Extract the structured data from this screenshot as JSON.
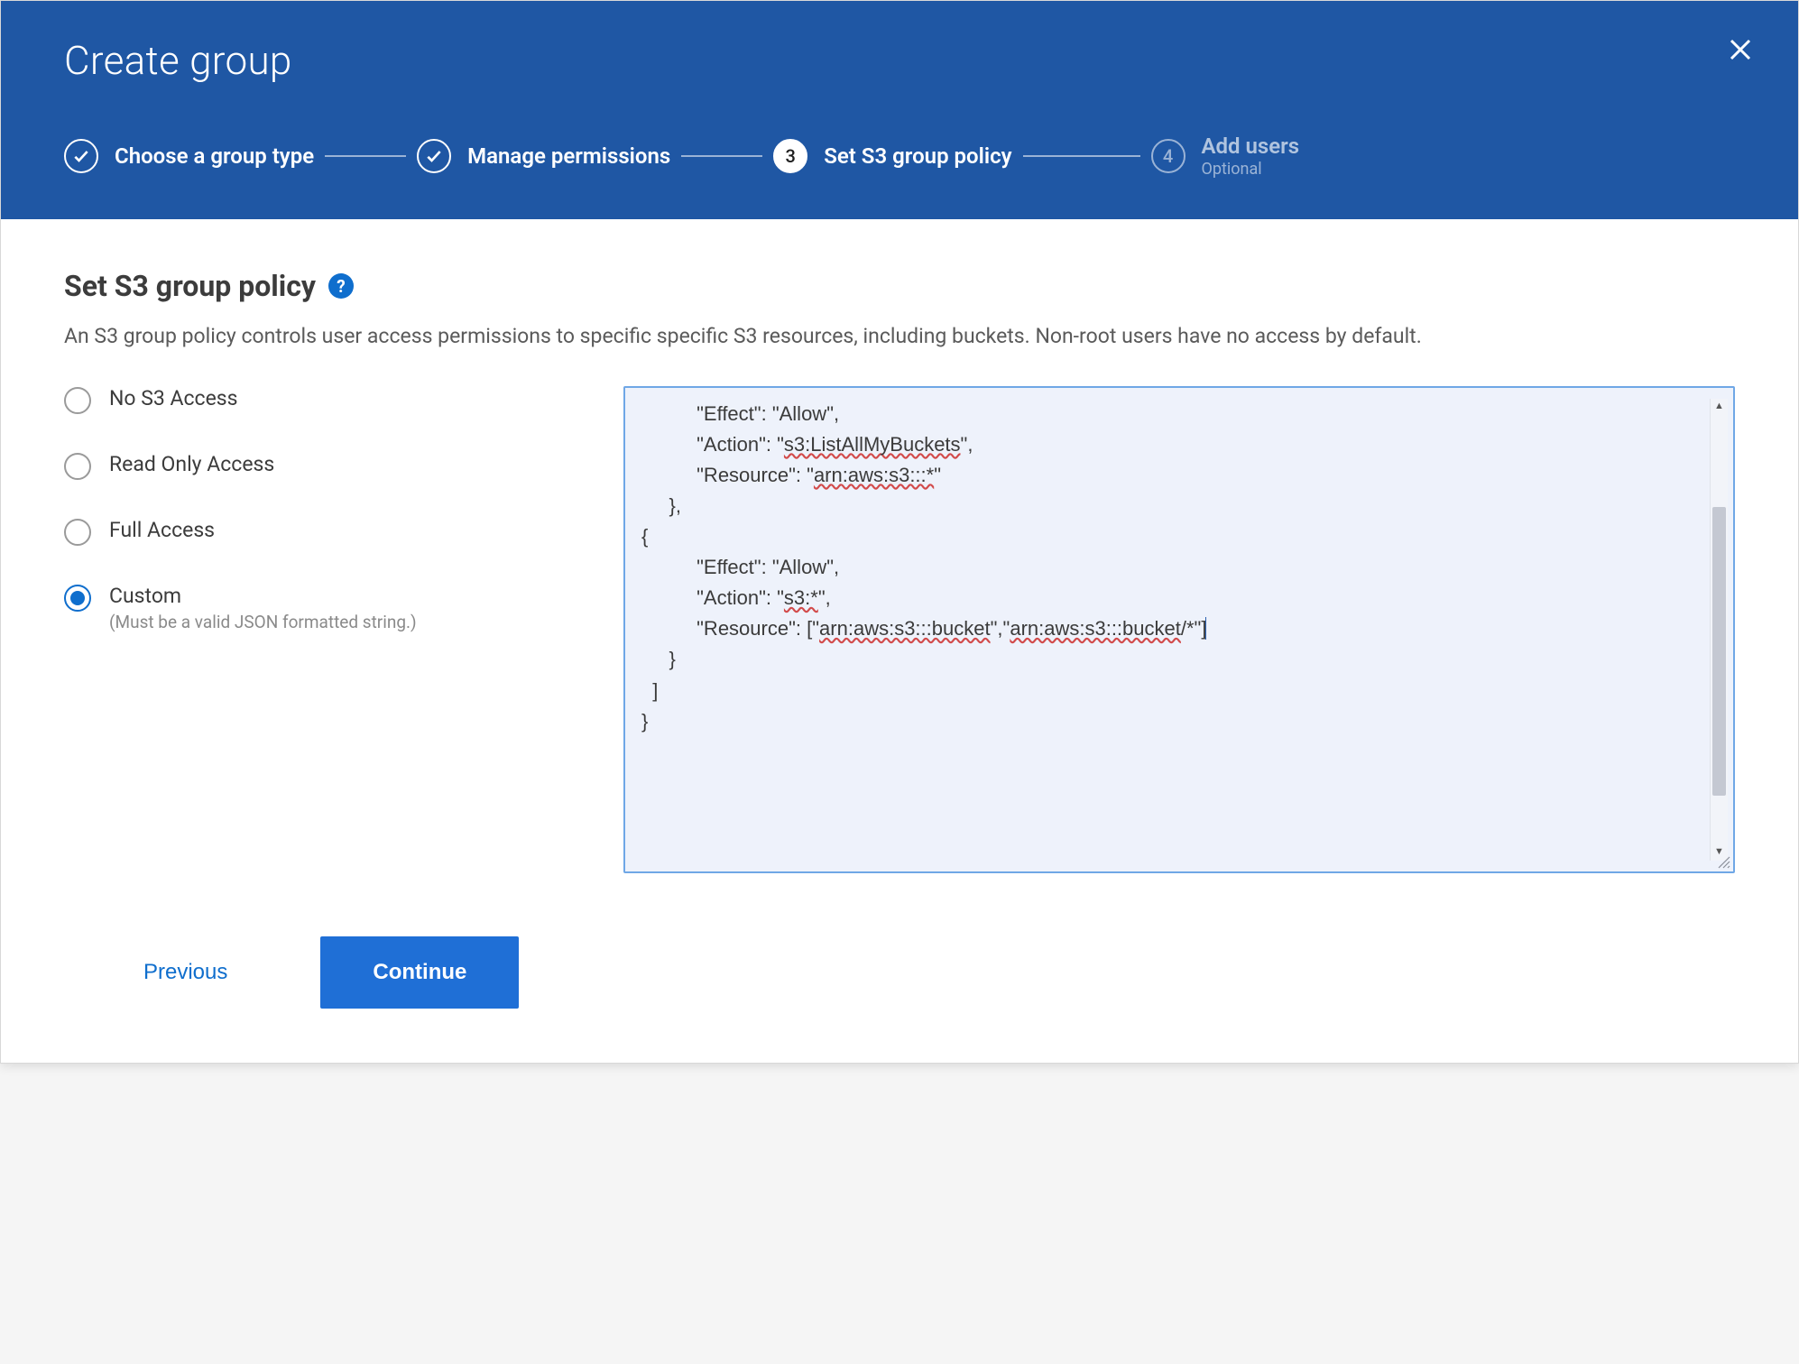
{
  "header": {
    "title": "Create group"
  },
  "stepper": {
    "steps": [
      {
        "label": "Choose a group type",
        "state": "done"
      },
      {
        "label": "Manage permissions",
        "state": "done"
      },
      {
        "number": "3",
        "label": "Set S3 group policy",
        "state": "active"
      },
      {
        "number": "4",
        "label": "Add users",
        "sub": "Optional",
        "state": "future"
      }
    ]
  },
  "section": {
    "title": "Set S3 group policy",
    "help": "?",
    "description": "An S3 group policy controls user access permissions to specific specific S3 resources, including buckets. Non-root users have no access by default."
  },
  "radios": {
    "options": [
      {
        "label": "No S3 Access",
        "hint": ""
      },
      {
        "label": "Read Only Access",
        "hint": ""
      },
      {
        "label": "Full Access",
        "hint": ""
      },
      {
        "label": "Custom",
        "hint": "(Must be a valid JSON formatted string.)",
        "selected": true
      }
    ]
  },
  "editor": {
    "indent0": "          \"Effect\": \"Allow\",",
    "action_pre": "          \"Action\": \"",
    "action_u1": "s3:ListAllMyBuckets",
    "action_post": "\",",
    "resource_pre": "          \"Resource\": \"",
    "resource_u1": "arn:aws:s3:::*",
    "resource_post": "\"",
    "close1": "     },",
    "open2": "{",
    "effect2": "          \"Effect\": \"Allow\",",
    "action2_pre": "          \"Action\": \"",
    "action2_u": "s3:*",
    "action2_post": "\",",
    "res2_pre": "          \"Resource\": [\"",
    "res2_u1": "arn:aws:s3:::bucket",
    "res2_mid": "\",\"",
    "res2_u2": "arn:aws:s3:::bucket",
    "res2_post": "/*\"]",
    "close2": "     }",
    "close3": "  ]",
    "close4": "}"
  },
  "footer": {
    "previous": "Previous",
    "continue": "Continue"
  }
}
